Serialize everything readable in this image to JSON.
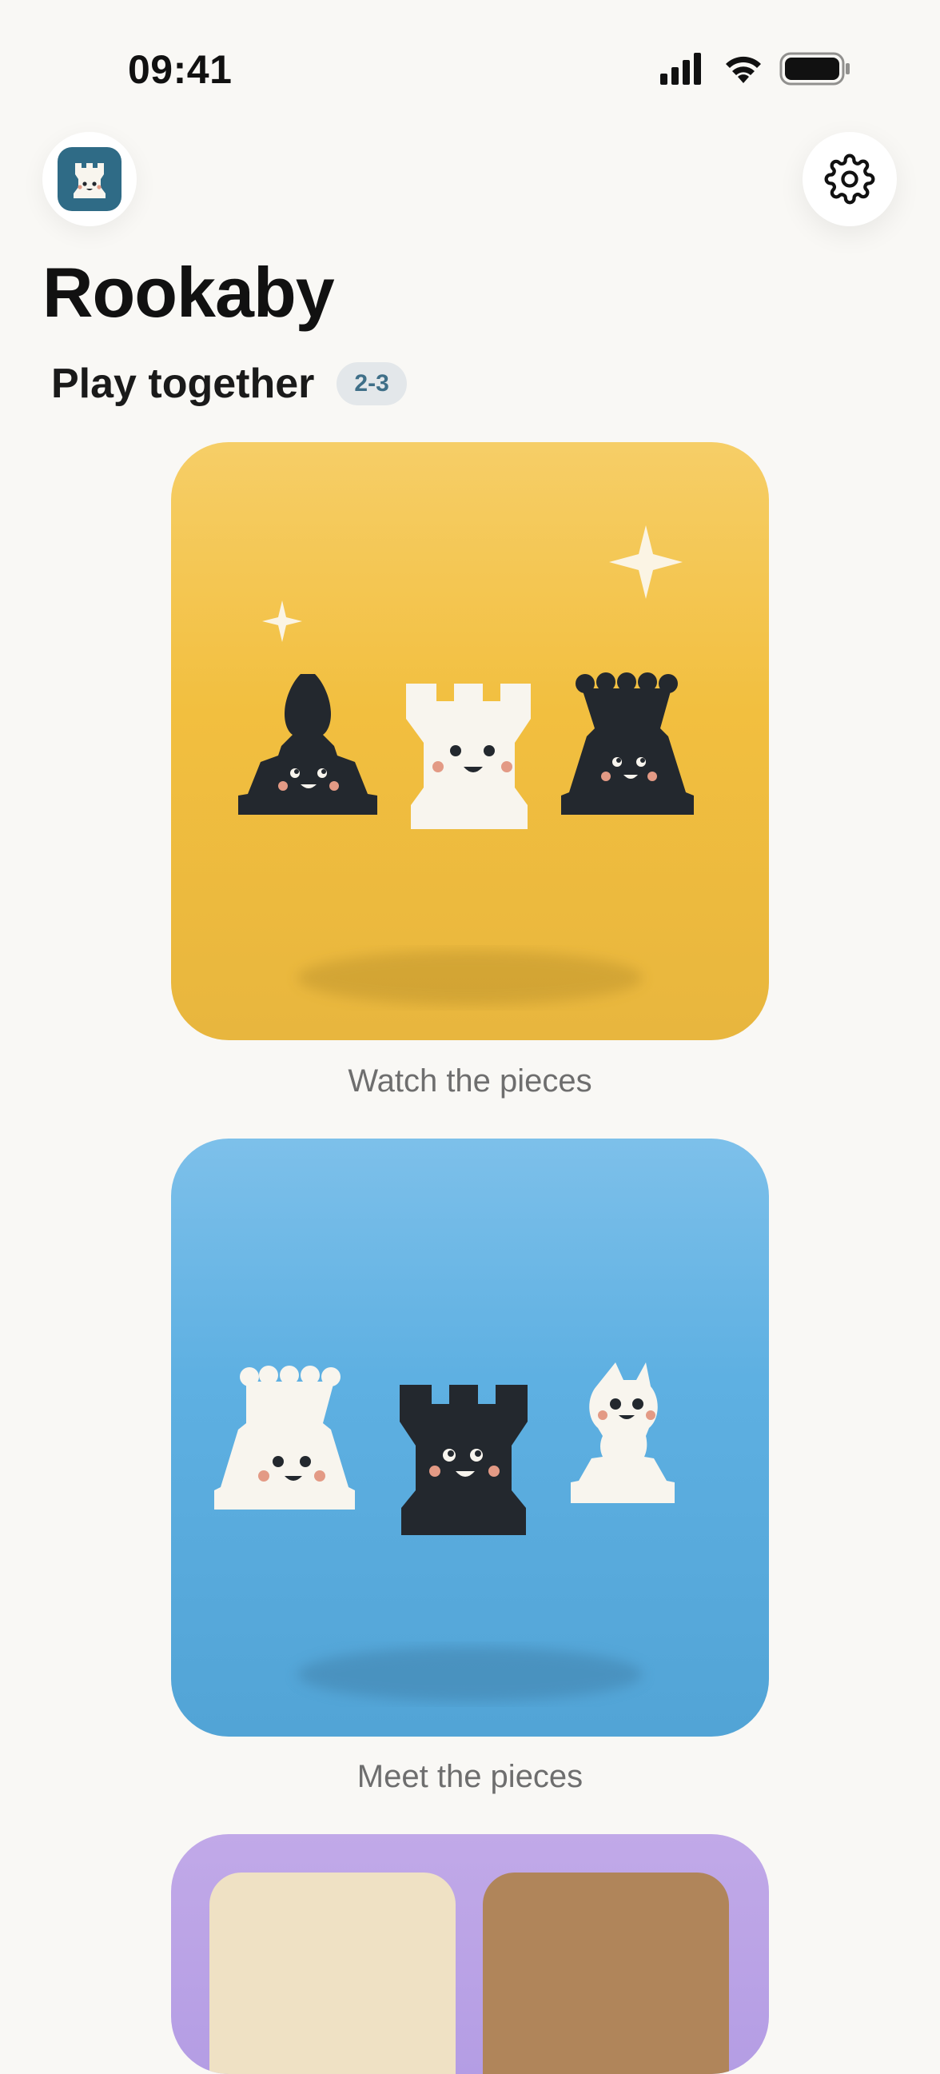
{
  "status_bar": {
    "time": "09:41",
    "icons": [
      "signal-icon",
      "wifi-icon",
      "battery-icon"
    ]
  },
  "header": {
    "app_icon": "rook-app-icon",
    "settings_icon": "gear-icon"
  },
  "title": "Rookaby",
  "subtitle": "Play together",
  "age_badge": "2-3",
  "cards": [
    {
      "label": "Watch the pieces",
      "color": "#f2bf3f"
    },
    {
      "label": "Meet the pieces",
      "color": "#5eb0e2"
    },
    {
      "label": "",
      "color": "#b8a0e6"
    }
  ],
  "colors": {
    "background": "#f9f8f5",
    "piece_dark": "#23282e",
    "piece_light": "#f8f5ee",
    "cheek": "#e39a85",
    "badge_text": "#3f6f88"
  }
}
